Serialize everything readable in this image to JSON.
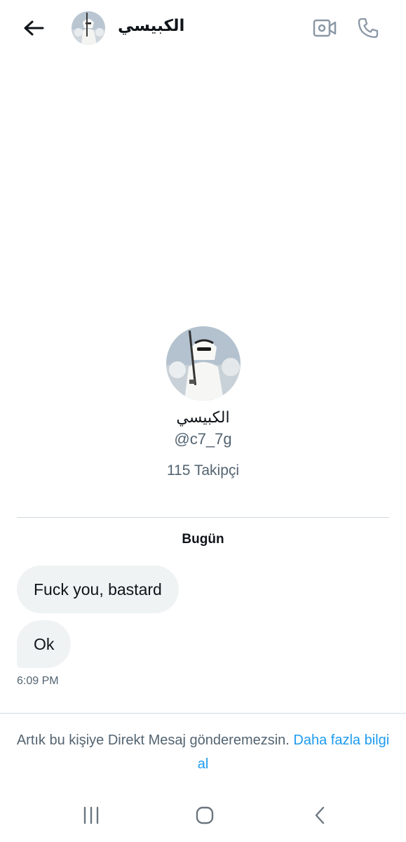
{
  "header": {
    "contact_name": "الكبيسي",
    "icons": {
      "back": "arrow-left-icon",
      "video": "video-call-icon",
      "call": "phone-icon"
    }
  },
  "profile": {
    "display_name": "الكبيسي",
    "handle": "@c7_7g",
    "followers": "115 Takipçi"
  },
  "conversation": {
    "date_separator": "Bugün",
    "messages": [
      {
        "text": "Fuck you, bastard"
      },
      {
        "text": "Ok"
      }
    ],
    "last_timestamp": "6:09 PM"
  },
  "notice": {
    "text": "Artık bu kişiye Direkt Mesaj gönderemezsin.",
    "link_text": "Daha fazla bilgi al"
  },
  "navbar": {
    "icons": [
      "recents-icon",
      "home-icon",
      "back-chevron-icon"
    ]
  },
  "colors": {
    "text_primary": "#0f1419",
    "text_secondary": "#536471",
    "accent": "#1d9bf0",
    "bubble_bg": "#eff3f4",
    "divider": "#cfd9de"
  }
}
